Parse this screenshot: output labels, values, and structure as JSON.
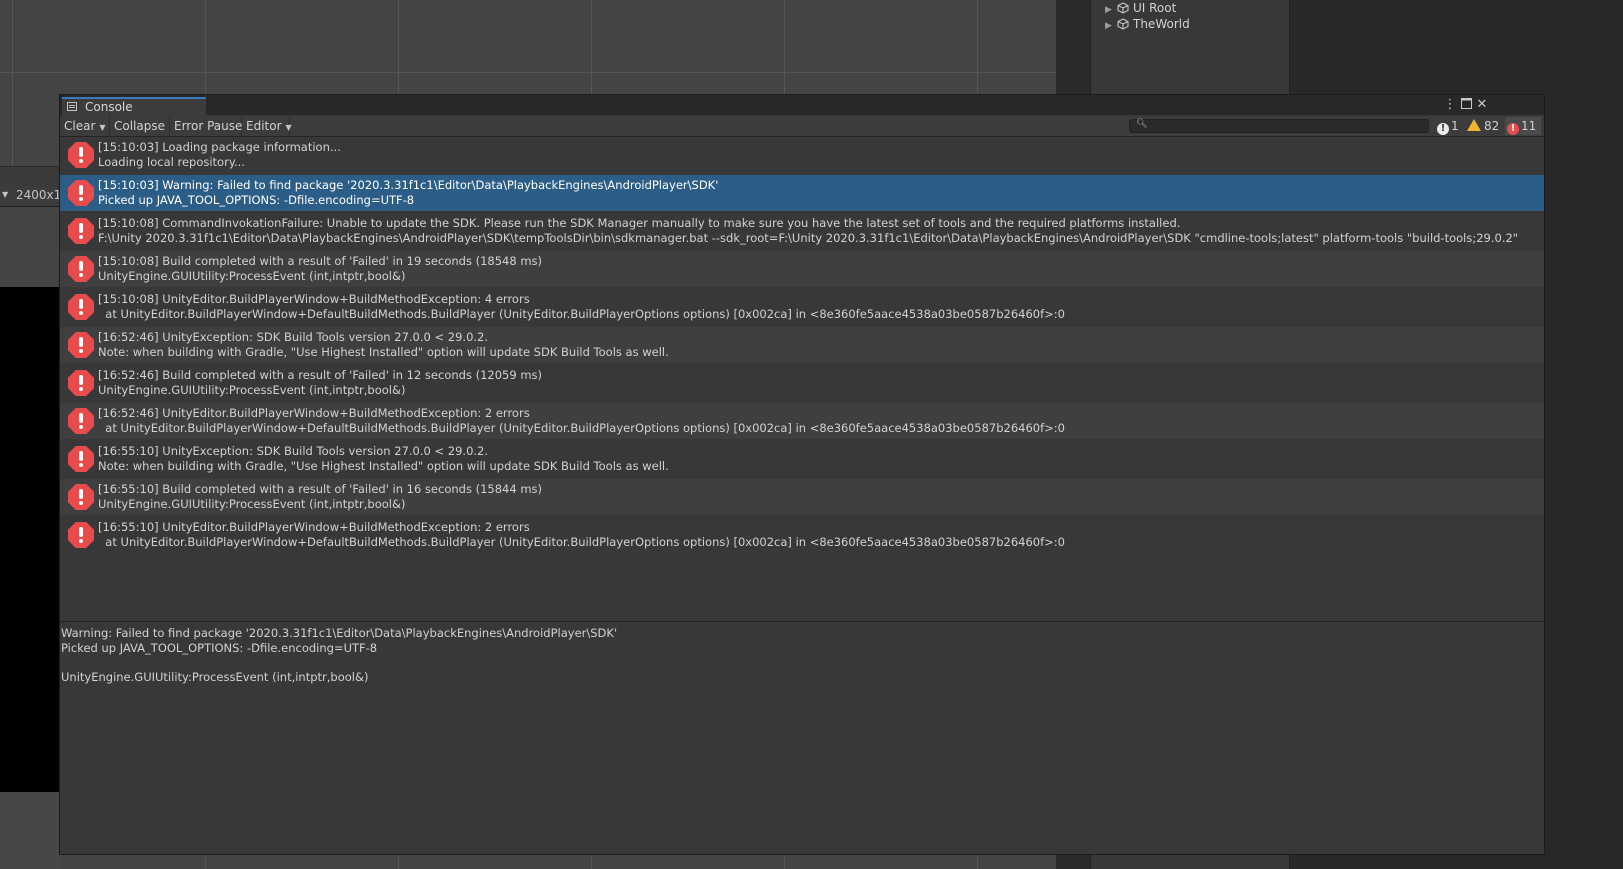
{
  "scene": {
    "resolution_label": "2400x1"
  },
  "hierarchy": {
    "items": [
      {
        "label": "UI Root"
      },
      {
        "label": "TheWorld"
      }
    ]
  },
  "console": {
    "tab_label": "Console",
    "toolbar": {
      "clear_label": "Clear",
      "collapse_label": "Collapse",
      "error_pause_label": "Error Pause",
      "editor_label": "Editor",
      "search_placeholder": ""
    },
    "counts": {
      "info": "1",
      "warnings": "82",
      "errors": "11"
    },
    "entries": [
      {
        "line1": "[15:10:03] Loading package information...",
        "line2": "Loading local repository..."
      },
      {
        "line1": "[15:10:03] Warning: Failed to find package '2020.3.31f1c1\\Editor\\Data\\PlaybackEngines\\AndroidPlayer\\SDK'",
        "line2": "Picked up JAVA_TOOL_OPTIONS: -Dfile.encoding=UTF-8"
      },
      {
        "line1": "[15:10:08] CommandInvokationFailure: Unable to update the SDK. Please run the SDK Manager manually to make sure you have the latest set of tools and the required platforms installed.",
        "line2": "F:\\Unity 2020.3.31f1c1\\Editor\\Data\\PlaybackEngines\\AndroidPlayer\\SDK\\tempToolsDir\\bin\\sdkmanager.bat --sdk_root=F:\\Unity 2020.3.31f1c1\\Editor\\Data\\PlaybackEngines\\AndroidPlayer\\SDK \"cmdline-tools;latest\" platform-tools \"build-tools;29.0.2\""
      },
      {
        "line1": "[15:10:08] Build completed with a result of 'Failed' in 19 seconds (18548 ms)",
        "line2": "UnityEngine.GUIUtility:ProcessEvent (int,intptr,bool&)"
      },
      {
        "line1": "[15:10:08] UnityEditor.BuildPlayerWindow+BuildMethodException: 4 errors",
        "line2": "  at UnityEditor.BuildPlayerWindow+DefaultBuildMethods.BuildPlayer (UnityEditor.BuildPlayerOptions options) [0x002ca] in <8e360fe5aace4538a03be0587b26460f>:0"
      },
      {
        "line1": "[16:52:46] UnityException: SDK Build Tools version 27.0.0 < 29.0.2.",
        "line2": "Note: when building with Gradle, \"Use Highest Installed\" option will update SDK Build Tools as well."
      },
      {
        "line1": "[16:52:46] Build completed with a result of 'Failed' in 12 seconds (12059 ms)",
        "line2": "UnityEngine.GUIUtility:ProcessEvent (int,intptr,bool&)"
      },
      {
        "line1": "[16:52:46] UnityEditor.BuildPlayerWindow+BuildMethodException: 2 errors",
        "line2": "  at UnityEditor.BuildPlayerWindow+DefaultBuildMethods.BuildPlayer (UnityEditor.BuildPlayerOptions options) [0x002ca] in <8e360fe5aace4538a03be0587b26460f>:0"
      },
      {
        "line1": "[16:55:10] UnityException: SDK Build Tools version 27.0.0 < 29.0.2.",
        "line2": "Note: when building with Gradle, \"Use Highest Installed\" option will update SDK Build Tools as well."
      },
      {
        "line1": "[16:55:10] Build completed with a result of 'Failed' in 16 seconds (15844 ms)",
        "line2": "UnityEngine.GUIUtility:ProcessEvent (int,intptr,bool&)"
      },
      {
        "line1": "[16:55:10] UnityEditor.BuildPlayerWindow+BuildMethodException: 2 errors",
        "line2": "  at UnityEditor.BuildPlayerWindow+DefaultBuildMethods.BuildPlayer (UnityEditor.BuildPlayerOptions options) [0x002ca] in <8e360fe5aace4538a03be0587b26460f>:0"
      }
    ],
    "detail": {
      "lines": [
        "Warning: Failed to find package '2020.3.31f1c1\\Editor\\Data\\PlaybackEngines\\AndroidPlayer\\SDK'",
        "Picked up JAVA_TOOL_OPTIONS: -Dfile.encoding=UTF-8",
        "",
        "UnityEngine.GUIUtility:ProcessEvent (int,intptr,bool&)"
      ]
    }
  },
  "colors": {
    "error": "#e84b4b",
    "warning": "#f2b430",
    "selection": "#2c5d87",
    "tab_accent": "#3a79bb"
  }
}
